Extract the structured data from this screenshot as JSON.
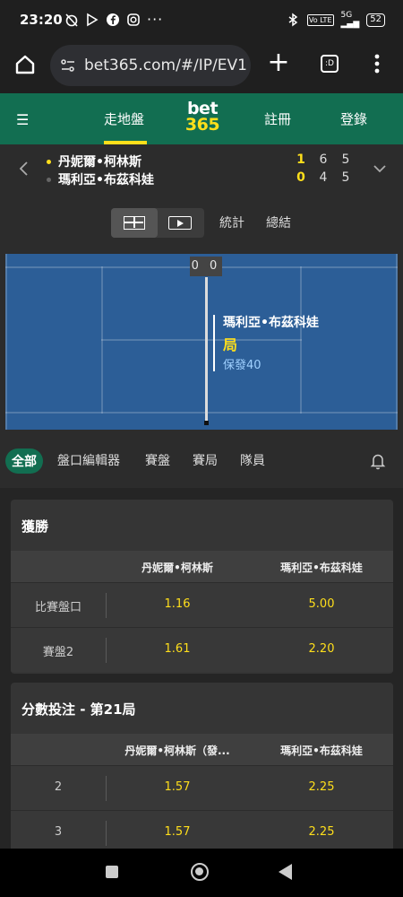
{
  "status_bar": {
    "time": "23:20",
    "more": "···",
    "battery": "52",
    "network": "5G",
    "volte": "Vo LTE"
  },
  "browser": {
    "url": "bet365.com/#/IP/EV1",
    "tabs_label": ":D"
  },
  "header": {
    "inplay": "走地盤",
    "logo_top": "bet",
    "logo_bottom": "365",
    "join": "註冊",
    "login": "登錄",
    "brand_green": "#126e51",
    "accent_yellow": "#ffdf1b"
  },
  "match": {
    "players": [
      {
        "name": "丹妮爾•柯林斯",
        "sets": [
          "1",
          "6",
          "5"
        ],
        "serving": true
      },
      {
        "name": "瑪利亞•布茲科娃",
        "sets": [
          "0",
          "4",
          "5"
        ],
        "serving": false
      }
    ]
  },
  "view": {
    "stats": "統計",
    "summary": "總結"
  },
  "court": {
    "points": "0 0",
    "server_name": "瑪利亞•布茲科娃",
    "game_label": "局",
    "point_text": "保發40"
  },
  "filters": {
    "all": "全部",
    "bet_builder": "盤口編輯器",
    "set": "賽盤",
    "game": "賽局",
    "team": "隊員"
  },
  "markets": [
    {
      "title": "獲勝",
      "columns": [
        "丹妮爾•柯林斯",
        "瑪利亞•布茲科娃"
      ],
      "rows": [
        {
          "label": "比賽盤口",
          "odds": [
            "1.16",
            "5.00"
          ]
        },
        {
          "label": "賽盤2",
          "odds": [
            "1.61",
            "2.20"
          ]
        }
      ]
    },
    {
      "title": "分數投注 - 第21局",
      "columns": [
        "丹妮爾•柯林斯（發...",
        "瑪利亞•布茲科娃"
      ],
      "rows": [
        {
          "label": "2",
          "odds": [
            "1.57",
            "2.25"
          ]
        },
        {
          "label": "3",
          "odds": [
            "1.57",
            "2.25"
          ]
        }
      ]
    }
  ]
}
